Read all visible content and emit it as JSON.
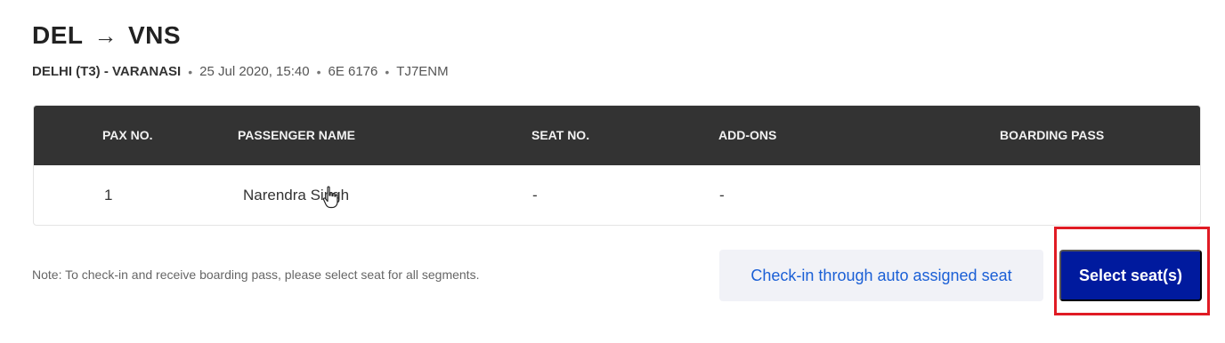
{
  "route": {
    "from": "DEL",
    "arrow": "→",
    "to": "VNS"
  },
  "flight_info": {
    "sector": "DELHI (T3) - VARANASI",
    "separator": "•",
    "datetime": "25 Jul 2020, 15:40",
    "flight_no": "6E 6176",
    "pnr": "TJ7ENM"
  },
  "table": {
    "headers": [
      "PAX NO.",
      "PASSENGER NAME",
      "SEAT NO.",
      "ADD-ONS",
      "BOARDING PASS"
    ],
    "rows": [
      {
        "pax_no": "1",
        "name": "Narendra Singh",
        "seat": "-",
        "addons": "-",
        "boarding_pass": ""
      }
    ]
  },
  "footer": {
    "note": "Note: To check-in and receive boarding pass, please select seat for all segments.",
    "auto_checkin_label": "Check-in through auto assigned seat",
    "select_seats_label": "Select seat(s)"
  },
  "colors": {
    "header_bg": "#333333",
    "primary_button": "#001a9e",
    "secondary_button_bg": "#f1f2f7",
    "link_blue": "#1a5fd6",
    "highlight_red": "#e01b24"
  },
  "icons": {
    "cursor": "hand-pointer-icon"
  }
}
